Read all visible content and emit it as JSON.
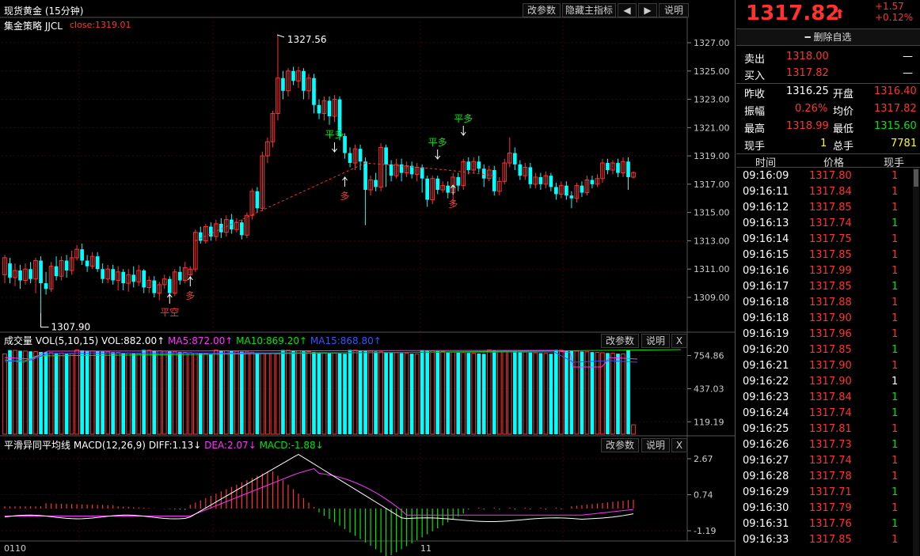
{
  "chart_title": "现货黄金 (15分钟)",
  "buttons": {
    "params": "改参数",
    "hide_indicator": "隐藏主指标",
    "prev": "◀",
    "next": "▶",
    "help": "说明",
    "close": "X"
  },
  "main": {
    "strategy": "集金策略 JJCL",
    "close_label": "close:1319.01",
    "y_ticks": [
      "1327.00",
      "1325.00",
      "1323.00",
      "1321.00",
      "1319.00",
      "1317.00",
      "1315.00",
      "1313.00",
      "1311.00",
      "1309.00"
    ],
    "high_label": "1327.56",
    "low_label": "1307.90",
    "signals": [
      "平空",
      "多",
      "平多",
      "多",
      "平多",
      "平多",
      "多"
    ]
  },
  "vol": {
    "name": "成交量",
    "params": "VOL(5,10,15)",
    "vol": "VOL:882.00↑",
    "ma5": "MA5:872.00↑",
    "ma10": "MA10:869.20↑",
    "ma15": "MA15:868.80↑",
    "y_ticks": [
      "754.86",
      "437.03",
      "119.19"
    ]
  },
  "macd": {
    "name": "平滑异同平均线",
    "params": "MACD(12,26,9)",
    "diff": "DIFF:1.13↓",
    "dea": "DEA:2.07↓",
    "macd": "MACD:-1.88↓",
    "y_ticks": [
      "2.67",
      "0.74",
      "-1.19"
    ]
  },
  "x_axis": {
    "left": "0110",
    "mid": "11"
  },
  "quote": {
    "price": "1317.82",
    "arrow": "⬆",
    "change": "+1.57",
    "change_pct": "+0.12%",
    "delete_fav": "删除自选",
    "sell_label": "卖出",
    "sell": "1318.00",
    "sell_vol": "—",
    "buy_label": "买入",
    "buy": "1317.82",
    "buy_vol": "—",
    "prev_close_label": "昨收",
    "prev_close": "1316.25",
    "open_label": "开盘",
    "open": "1316.40",
    "amp_label": "振幅",
    "amp": "0.26%",
    "avg_label": "均价",
    "avg": "1317.82",
    "high_label": "最高",
    "high": "1318.99",
    "low_label": "最低",
    "low": "1315.60",
    "cur_hand_label": "现手",
    "cur_hand": "1",
    "total_hand_label": "总手",
    "total_hand": "7781"
  },
  "ticks": {
    "headers": [
      "时间",
      "价格",
      "现手"
    ],
    "rows": [
      {
        "t": "09:16:09",
        "p": "1317.80",
        "v": "1",
        "c": "red"
      },
      {
        "t": "09:16:11",
        "p": "1317.84",
        "v": "1",
        "c": "red"
      },
      {
        "t": "09:16:12",
        "p": "1317.85",
        "v": "1",
        "c": "red"
      },
      {
        "t": "09:16:13",
        "p": "1317.74",
        "v": "1",
        "c": "grn"
      },
      {
        "t": "09:16:14",
        "p": "1317.75",
        "v": "1",
        "c": "red"
      },
      {
        "t": "09:16:15",
        "p": "1317.85",
        "v": "1",
        "c": "red"
      },
      {
        "t": "09:16:16",
        "p": "1317.99",
        "v": "1",
        "c": "red"
      },
      {
        "t": "09:16:17",
        "p": "1317.85",
        "v": "1",
        "c": "grn"
      },
      {
        "t": "09:16:18",
        "p": "1317.88",
        "v": "1",
        "c": "red"
      },
      {
        "t": "09:16:18",
        "p": "1317.90",
        "v": "1",
        "c": "red"
      },
      {
        "t": "09:16:19",
        "p": "1317.96",
        "v": "1",
        "c": "red"
      },
      {
        "t": "09:16:20",
        "p": "1317.85",
        "v": "1",
        "c": "grn"
      },
      {
        "t": "09:16:21",
        "p": "1317.90",
        "v": "1",
        "c": "red"
      },
      {
        "t": "09:16:22",
        "p": "1317.90",
        "v": "1",
        "c": "wht"
      },
      {
        "t": "09:16:23",
        "p": "1317.84",
        "v": "1",
        "c": "grn"
      },
      {
        "t": "09:16:24",
        "p": "1317.74",
        "v": "1",
        "c": "grn"
      },
      {
        "t": "09:16:25",
        "p": "1317.81",
        "v": "1",
        "c": "red"
      },
      {
        "t": "09:16:26",
        "p": "1317.73",
        "v": "1",
        "c": "grn"
      },
      {
        "t": "09:16:27",
        "p": "1317.74",
        "v": "1",
        "c": "red"
      },
      {
        "t": "09:16:28",
        "p": "1317.78",
        "v": "1",
        "c": "red"
      },
      {
        "t": "09:16:29",
        "p": "1317.71",
        "v": "1",
        "c": "grn"
      },
      {
        "t": "09:16:30",
        "p": "1317.79",
        "v": "1",
        "c": "red"
      },
      {
        "t": "09:16:31",
        "p": "1317.76",
        "v": "1",
        "c": "grn"
      },
      {
        "t": "09:16:33",
        "p": "1317.85",
        "v": "1",
        "c": "red"
      }
    ]
  }
}
